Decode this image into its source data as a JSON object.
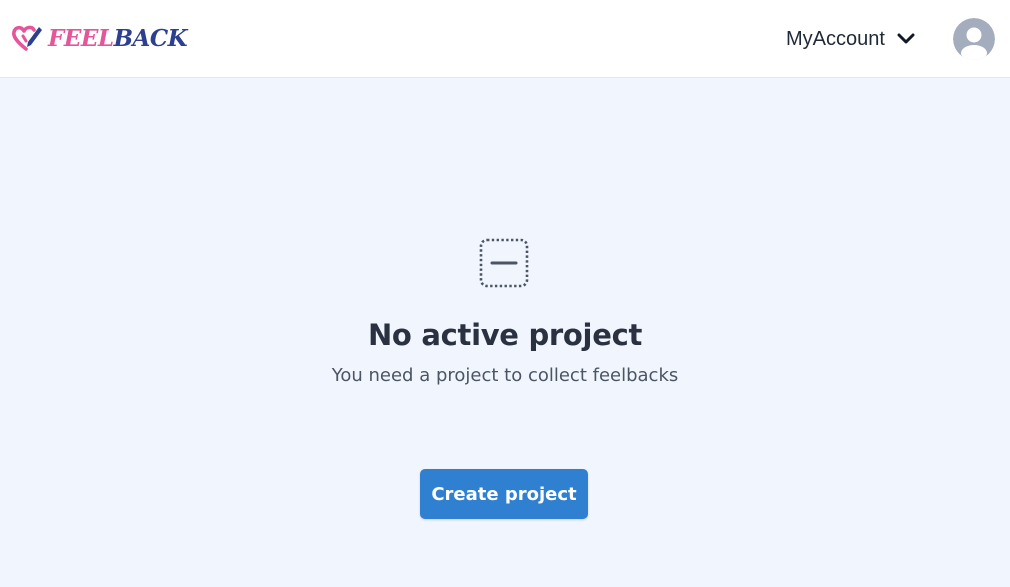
{
  "header": {
    "logo": {
      "text_part1": "FEEL",
      "text_part2": "BACK",
      "icon": "heart-pencil-icon"
    },
    "account": {
      "label": "MyAccount",
      "icon": "chevron-down-icon"
    },
    "avatar": {
      "icon": "user-avatar-icon"
    }
  },
  "main": {
    "empty_state": {
      "icon": "minus-square-dashed-icon",
      "title": "No active project",
      "subtitle": "You need a project to collect feelbacks",
      "button_label": "Create project"
    }
  },
  "colors": {
    "background": "#f1f5fd",
    "header": "#ffffff",
    "primary": "#2f80d1",
    "logo_pink": "#e5559a",
    "logo_navy": "#2d3f8f",
    "avatar_gray": "#a4adbd"
  }
}
